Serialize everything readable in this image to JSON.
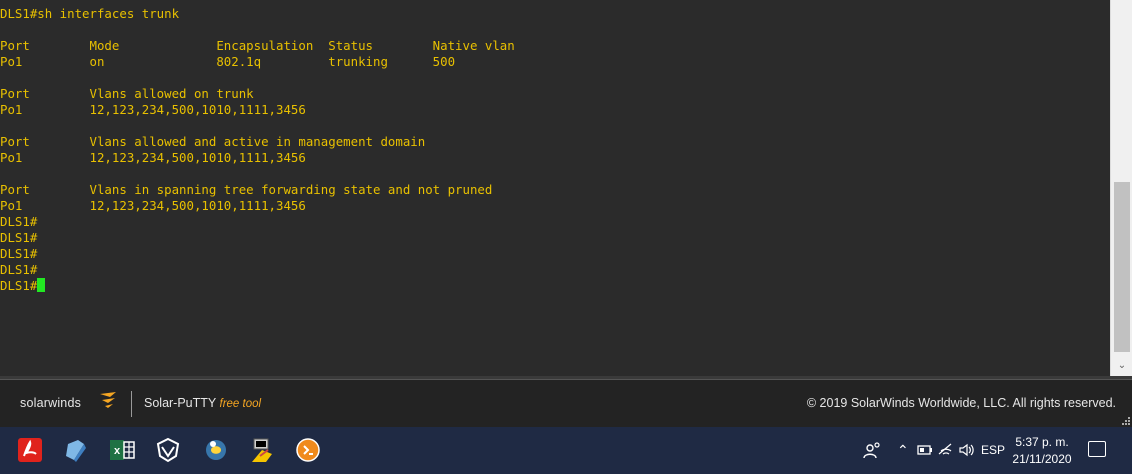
{
  "terminal": {
    "lines": [
      "DLS1#sh interfaces trunk",
      "",
      "Port        Mode             Encapsulation  Status        Native vlan",
      "Po1         on               802.1q         trunking      500",
      "",
      "Port        Vlans allowed on trunk",
      "Po1         12,123,234,500,1010,1111,3456",
      "",
      "Port        Vlans allowed and active in management domain",
      "Po1         12,123,234,500,1010,1111,3456",
      "",
      "Port        Vlans in spanning tree forwarding state and not pruned",
      "Po1         12,123,234,500,1010,1111,3456",
      "DLS1#",
      "DLS1#",
      "DLS1#",
      "DLS1#"
    ],
    "prompt": "DLS1#",
    "colors": {
      "background": "#2b2b2b",
      "text": "#e8c000",
      "cursor": "#22e822"
    }
  },
  "footer": {
    "logo_text": "solarwinds",
    "product_name": "Solar-PuTTY",
    "product_tag": "free tool",
    "copyright": "© 2019 SolarWinds Worldwide, LLC. All rights reserved."
  },
  "taskbar": {
    "apps": [
      "acrobat-reader-icon",
      "notepad-icon",
      "excel-icon",
      "virtualbox-icon",
      "python-icon",
      "putty-icon",
      "solar-putty-icon"
    ],
    "language": "ESP",
    "time": "5:37 p. m.",
    "date": "21/11/2020"
  }
}
